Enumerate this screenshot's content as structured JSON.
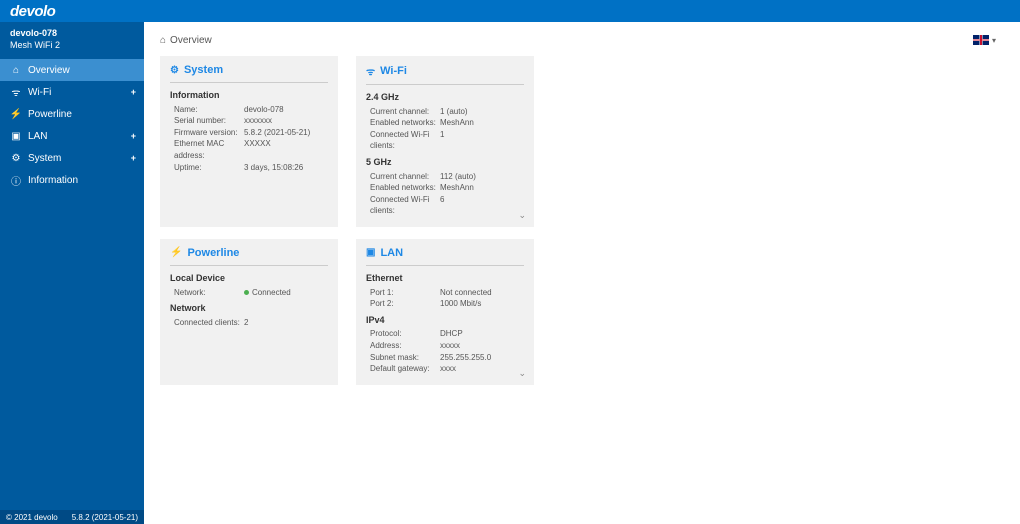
{
  "brand": "devolo",
  "device": {
    "name": "devolo-078",
    "model": "Mesh WiFi 2"
  },
  "footer": {
    "copyright": "© 2021 devolo",
    "version": "5.8.2 (2021-05-21)"
  },
  "breadcrumb": {
    "title": "Overview"
  },
  "nav": [
    {
      "label": "Overview",
      "icon": "⌂",
      "active": true,
      "expand": false
    },
    {
      "label": "Wi-Fi",
      "icon": "ᯤ",
      "active": false,
      "expand": true
    },
    {
      "label": "Powerline",
      "icon": "⚡",
      "active": false,
      "expand": false
    },
    {
      "label": "LAN",
      "icon": "▣",
      "active": false,
      "expand": true
    },
    {
      "label": "System",
      "icon": "⚙",
      "active": false,
      "expand": true
    },
    {
      "label": "Information",
      "icon": "ⓘ",
      "active": false,
      "expand": false
    }
  ],
  "cards": {
    "system": {
      "title": "System",
      "sections": [
        {
          "heading": "Information",
          "rows": [
            {
              "k": "Name:",
              "v": "devolo-078"
            },
            {
              "k": "Serial number:",
              "v": "xxxxxxx"
            },
            {
              "k": "Firmware version:",
              "v": "5.8.2 (2021-05-21)"
            },
            {
              "k": "Ethernet MAC address:",
              "v": "XXXXX"
            },
            {
              "k": "Uptime:",
              "v": "3 days, 15:08:26"
            }
          ]
        }
      ]
    },
    "wifi": {
      "title": "Wi-Fi",
      "sections": [
        {
          "heading": "2.4 GHz",
          "rows": [
            {
              "k": "Current channel:",
              "v": "1 (auto)"
            },
            {
              "k": "Enabled networks:",
              "v": "MeshAnn"
            },
            {
              "k": "Connected Wi-Fi clients:",
              "v": "1"
            }
          ]
        },
        {
          "heading": "5 GHz",
          "rows": [
            {
              "k": "Current channel:",
              "v": "112 (auto)"
            },
            {
              "k": "Enabled networks:",
              "v": "MeshAnn"
            },
            {
              "k": "Connected Wi-Fi clients:",
              "v": "6"
            }
          ]
        }
      ]
    },
    "powerline": {
      "title": "Powerline",
      "sections": [
        {
          "heading": "Local Device",
          "rows": [
            {
              "k": "Network:",
              "v": "Connected",
              "green": true
            }
          ]
        },
        {
          "heading": "Network",
          "rows": [
            {
              "k": "Connected clients:",
              "v": "2"
            }
          ]
        }
      ]
    },
    "lan": {
      "title": "LAN",
      "sections": [
        {
          "heading": "Ethernet",
          "rows": [
            {
              "k": "Port 1:",
              "v": "Not connected"
            },
            {
              "k": "Port 2:",
              "v": "1000 Mbit/s"
            }
          ]
        },
        {
          "heading": "IPv4",
          "rows": [
            {
              "k": "Protocol:",
              "v": "DHCP"
            },
            {
              "k": "Address:",
              "v": "xxxxx"
            },
            {
              "k": "Subnet mask:",
              "v": "255.255.255.0"
            },
            {
              "k": "Default gateway:",
              "v": "xxxx"
            }
          ]
        }
      ]
    }
  }
}
